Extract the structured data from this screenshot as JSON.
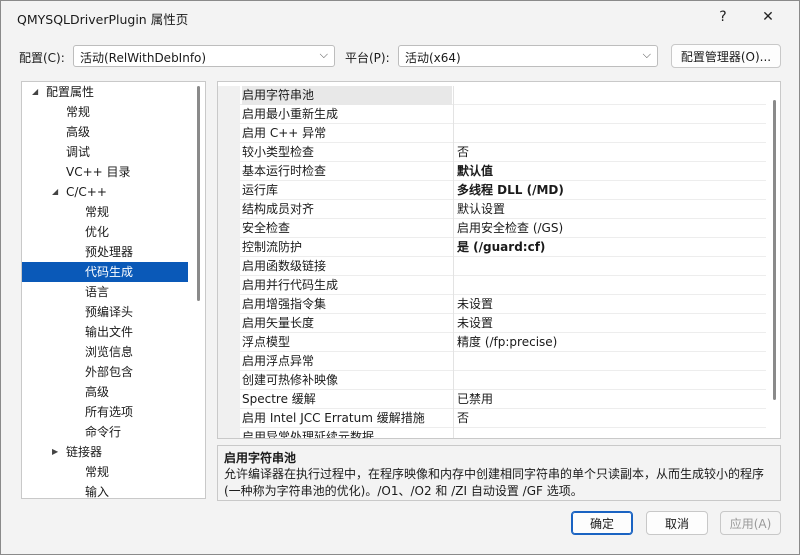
{
  "window": {
    "title": "QMYSQLDriverPlugin 属性页",
    "help": "?",
    "close": "✕"
  },
  "top": {
    "config_label": "配置(C):",
    "config_value": "活动(RelWithDebInfo)",
    "platform_label": "平台(P):",
    "platform_value": "活动(x64)",
    "config_manager_button": "配置管理器(O)..."
  },
  "tree": {
    "items": [
      {
        "label": "配置属性",
        "arrow": "◢"
      },
      {
        "label": "常规"
      },
      {
        "label": "高级"
      },
      {
        "label": "调试"
      },
      {
        "label": "VC++ 目录"
      },
      {
        "label": "C/C++",
        "arrow": "◢"
      },
      {
        "label": "常规"
      },
      {
        "label": "优化"
      },
      {
        "label": "预处理器"
      },
      {
        "label": "代码生成",
        "selected": true
      },
      {
        "label": "语言"
      },
      {
        "label": "预编译头"
      },
      {
        "label": "输出文件"
      },
      {
        "label": "浏览信息"
      },
      {
        "label": "外部包含"
      },
      {
        "label": "高级"
      },
      {
        "label": "所有选项"
      },
      {
        "label": "命令行"
      },
      {
        "label": "链接器",
        "arrow": "▶"
      },
      {
        "label": "常规"
      },
      {
        "label": "输入"
      }
    ]
  },
  "grid": {
    "rows": [
      {
        "name": "启用字符串池",
        "value": "",
        "selected": true
      },
      {
        "name": "启用最小重新生成",
        "value": ""
      },
      {
        "name": "启用 C++ 异常",
        "value": ""
      },
      {
        "name": "较小类型检查",
        "value": "否"
      },
      {
        "name": "基本运行时检查",
        "value": "默认值",
        "bold": true
      },
      {
        "name": "运行库",
        "value": "多线程 DLL (/MD)",
        "bold": true
      },
      {
        "name": "结构成员对齐",
        "value": "默认设置"
      },
      {
        "name": "安全检查",
        "value": "启用安全检查 (/GS)"
      },
      {
        "name": "控制流防护",
        "value": "是 (/guard:cf)",
        "bold": true
      },
      {
        "name": "启用函数级链接",
        "value": ""
      },
      {
        "name": "启用并行代码生成",
        "value": ""
      },
      {
        "name": "启用增强指令集",
        "value": "未设置"
      },
      {
        "name": "启用矢量长度",
        "value": "未设置"
      },
      {
        "name": "浮点模型",
        "value": "精度 (/fp:precise)"
      },
      {
        "name": "启用浮点异常",
        "value": ""
      },
      {
        "name": "创建可热修补映像",
        "value": ""
      },
      {
        "name": "Spectre 缓解",
        "value": "已禁用"
      },
      {
        "name": "启用 Intel JCC Erratum 缓解措施",
        "value": "否"
      },
      {
        "name": "启用异常处理延续元数据",
        "value": ""
      }
    ]
  },
  "description": {
    "title": "启用字符串池",
    "text": "允许编译器在执行过程中，在程序映像和内存中创建相同字符串的单个只读副本，从而生成较小的程序(一种称为字符串池的优化)。/O1、/O2 和 /ZI 自动设置 /GF 选项。"
  },
  "buttons": {
    "ok": "确定",
    "cancel": "取消",
    "apply": "应用(A)"
  },
  "colors": {
    "selection": "#0a59b8",
    "primary_border": "#1a63c2"
  }
}
